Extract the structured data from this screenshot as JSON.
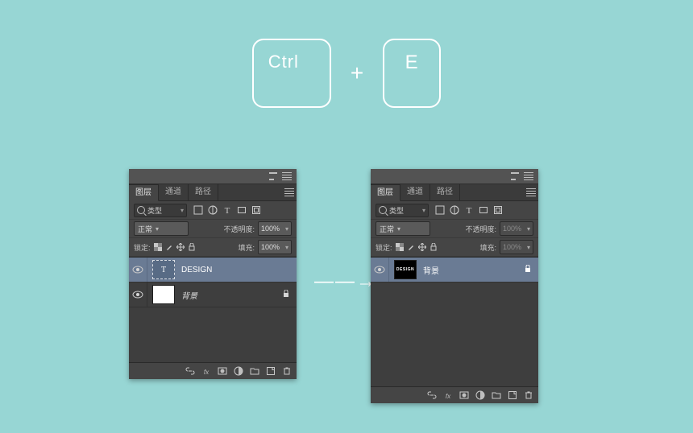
{
  "shortcut": {
    "key1": "Ctrl",
    "plus": "+",
    "key2": "E"
  },
  "arrow": "——→",
  "panel_common": {
    "tabs": {
      "layers": "图层",
      "channels": "通道",
      "paths": "路径"
    },
    "search_label": "类型",
    "blend_label": "正常",
    "opacity_label": "不透明度:",
    "opacity_value": "100%",
    "lock_label": "锁定:",
    "fill_label": "填充:",
    "fill_value": "100%",
    "footer_icons": [
      "link",
      "fx",
      "mask",
      "adjust",
      "group",
      "new",
      "trash"
    ]
  },
  "left_panel": {
    "layers": [
      {
        "name": "DESIGN",
        "kind": "type",
        "selected": true,
        "visible": true,
        "locked": false
      },
      {
        "name": "背景",
        "kind": "bg",
        "selected": false,
        "visible": true,
        "locked": true
      }
    ]
  },
  "right_panel": {
    "opacity_value": "100%",
    "fill_value": "100%",
    "layers": [
      {
        "name": "背景",
        "thumb_text": "DESIGN",
        "kind": "merged-bg",
        "selected": true,
        "visible": true,
        "locked": true
      }
    ]
  }
}
